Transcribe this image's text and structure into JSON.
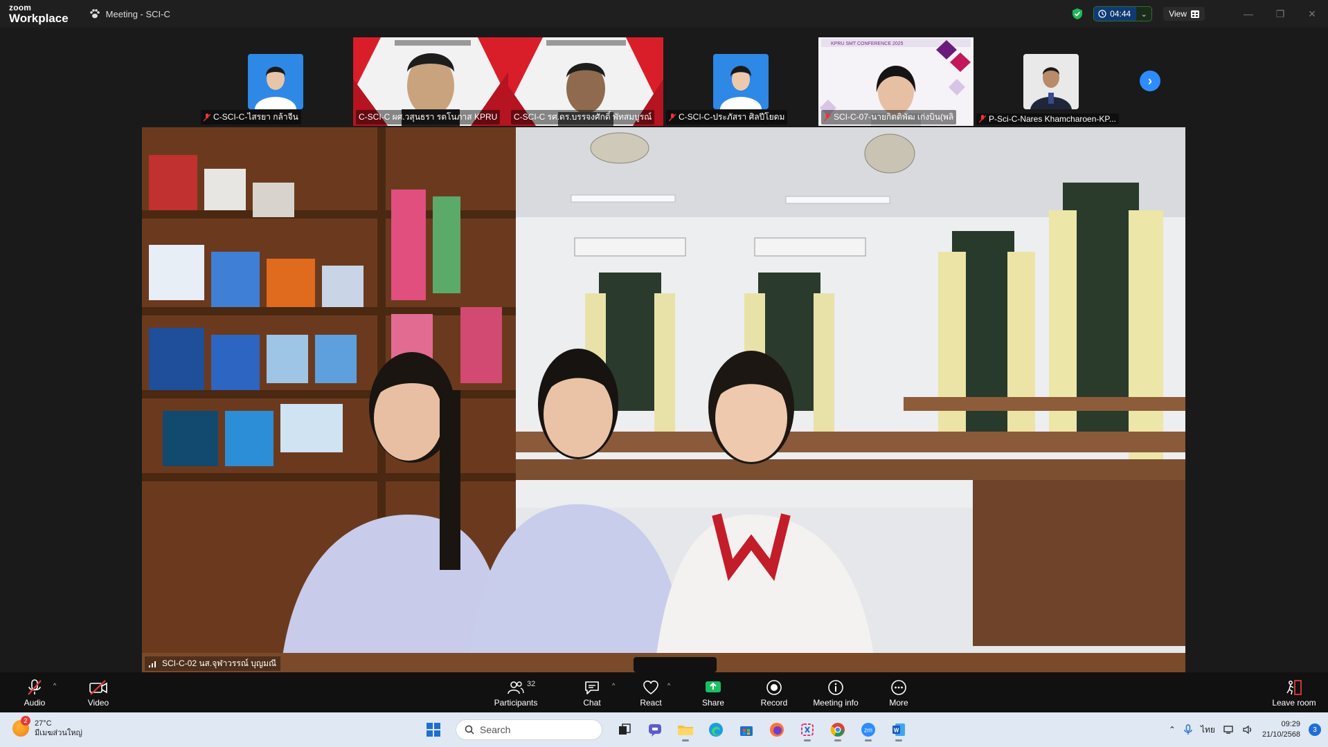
{
  "app": {
    "logo_top": "zoom",
    "logo_bottom": "Workplace",
    "meeting_title": "Meeting - SCI-C"
  },
  "titlebar": {
    "timer": "04:44",
    "view_label": "View"
  },
  "gallery": [
    {
      "name": "C-SCI-C-ไสรยา กล้าจีน",
      "kind": "avatar",
      "muted": true
    },
    {
      "name": "C-SCI-C ผศ.วสุนธรา รตโนภาส KPRU",
      "kind": "video",
      "muted": false
    },
    {
      "name": "C-SCI-C รศ.ดร.บรรจงศักดิ์ พัทสมบูรณ์",
      "kind": "video",
      "muted": false
    },
    {
      "name": "C-SCI-C-ประภัสรา ศิลปีโยดม",
      "kind": "avatar",
      "muted": true
    },
    {
      "name": "SCI-C-07-นายกิตติพัฒ เก่งบิน(พลิ",
      "kind": "video",
      "muted": true
    },
    {
      "name": "P-Sci-C-Nares Khamcharoen-KP...",
      "kind": "avatar",
      "muted": true
    }
  ],
  "gallery_banner": "KPRU SMT CONFERENCE 2025",
  "main_speaker": {
    "name": "SCI-C-02 นส.จุฬาวรรณ์ บุญมณี"
  },
  "toolbar": {
    "audio": "Audio",
    "video": "Video",
    "participants": "Participants",
    "participants_count": "32",
    "chat": "Chat",
    "react": "React",
    "share": "Share",
    "record": "Record",
    "meeting_info": "Meeting info",
    "more": "More",
    "leave": "Leave room"
  },
  "taskbar": {
    "weather_temp": "27°C",
    "weather_desc": "มีเมฆส่วนใหญ่",
    "weather_badge": "2",
    "search_placeholder": "Search",
    "lang": "ไทย",
    "time": "09:29",
    "date": "21/10/2568",
    "notif_count": "3"
  },
  "colors": {
    "accent": "#2d8cff",
    "share_green": "#19c062",
    "taskbar": "#dfe8f3"
  }
}
